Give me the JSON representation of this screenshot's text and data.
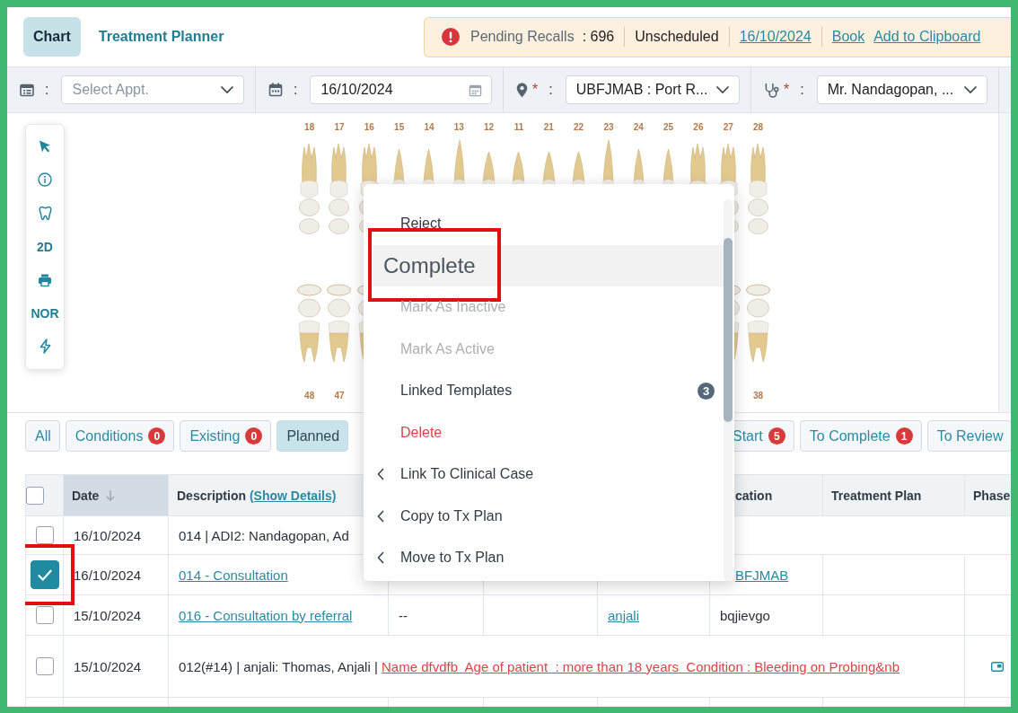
{
  "tabs": [
    {
      "label": "Chart",
      "selected": true
    },
    {
      "label": "Treatment Planner",
      "selected": false
    }
  ],
  "recall_banner": {
    "label": "Pending Recalls",
    "count": ": 696",
    "status": "Unscheduled",
    "date": "16/10/2024",
    "actions": [
      "Book",
      "Add to Clipboard"
    ]
  },
  "filters": [
    {
      "kind": "appointment",
      "separator": ":",
      "placeholder": "Select Appt."
    },
    {
      "kind": "date",
      "separator": ":",
      "value": "16/10/2024"
    },
    {
      "kind": "location",
      "required_mark": "*",
      "separator": ":",
      "value": "UBFJMAB : Port R..."
    },
    {
      "kind": "provider",
      "required_mark": "*",
      "separator": ":",
      "value": "Mr. Nandagopan, ..."
    }
  ],
  "chart_toolbar": [
    {
      "kind": "pointer"
    },
    {
      "kind": "info"
    },
    {
      "kind": "tooth"
    },
    {
      "kind": "text",
      "label": "2D"
    },
    {
      "kind": "print"
    },
    {
      "kind": "text",
      "label": "NOR"
    },
    {
      "kind": "bolt"
    }
  ],
  "tooth_chart": {
    "upper_numbers": [
      "18",
      "17",
      "16",
      "15",
      "14",
      "13",
      "12",
      "11",
      "21",
      "22",
      "23",
      "24",
      "25",
      "26",
      "27",
      "28"
    ],
    "lower_numbers": [
      "48",
      "47",
      "38"
    ]
  },
  "filter_chips": [
    {
      "label": "All",
      "selected": false
    },
    {
      "label": "Conditions",
      "count": "0",
      "selected": false
    },
    {
      "label": "Existing",
      "count": "0",
      "selected": false
    },
    {
      "label": "Planned",
      "selected": true
    },
    {
      "label": "Start",
      "count": "5",
      "selected": false
    },
    {
      "label": "To Complete",
      "count": "1",
      "selected": false
    },
    {
      "label": "To Review",
      "selected": false
    }
  ],
  "table": {
    "all_checked": false,
    "columns": [
      {
        "label": "Date",
        "sorted": true
      },
      {
        "label": "Description",
        "link": "(Show Details)",
        "sorted": false
      },
      {
        "label": "cation",
        "sorted": false
      },
      {
        "label": "Treatment Plan",
        "sorted": false
      },
      {
        "label": "Phase",
        "sorted": false
      }
    ],
    "rows": [
      {
        "kind": "summary",
        "checked": false,
        "highlighted": false,
        "date": "16/10/2024",
        "description": [
          {
            "kind": "plain",
            "text": "014 | ADI2: Nandagopan, Ad"
          }
        ]
      },
      {
        "kind": "detail",
        "checked": true,
        "highlighted": true,
        "date": "16/10/2024",
        "description": [
          {
            "kind": "link",
            "text": "014 - Consultation"
          }
        ],
        "location": {
          "kind": "link",
          "text": "BFJMAB"
        }
      },
      {
        "kind": "detail",
        "checked": false,
        "highlighted": false,
        "date": "15/10/2024",
        "description": [
          {
            "kind": "link",
            "text": "016 - Consultation by referral"
          }
        ],
        "column_4": {
          "kind": "plain",
          "text": "--"
        },
        "column_6": {
          "kind": "link",
          "text": "anjali"
        },
        "location": {
          "kind": "plain",
          "text": "bqjievgo"
        }
      },
      {
        "kind": "note",
        "checked": false,
        "highlighted": false,
        "date": "15/10/2024",
        "description": [
          {
            "kind": "plain",
            "text": "012(#14) | anjali: Thomas, Anjali | "
          },
          {
            "kind": "alert-link",
            "text": "Name dfvdfb  Age of patient  : more than 18 years  Condition : Bleeding on Probing&nb"
          }
        ]
      }
    ]
  },
  "context_menu": {
    "items": [
      {
        "label": "Reject",
        "kind": "normal",
        "hovered": false,
        "highlighted": false
      },
      {
        "label": "Complete",
        "kind": "normal",
        "hovered": true,
        "highlighted": true
      },
      {
        "label": "Mark As Inactive",
        "kind": "disabled",
        "hovered": false,
        "highlighted": false
      },
      {
        "label": "Mark As Active",
        "kind": "disabled",
        "hovered": false,
        "highlighted": false
      },
      {
        "label": "Linked Templates",
        "kind": "normal",
        "count": "3",
        "hovered": false,
        "highlighted": false
      },
      {
        "label": "Delete",
        "kind": "danger",
        "hovered": false,
        "highlighted": false
      },
      {
        "label": "Link To Clinical Case",
        "kind": "submenu",
        "hovered": false,
        "highlighted": false
      },
      {
        "label": "Copy to Tx Plan",
        "kind": "submenu",
        "hovered": false,
        "highlighted": false
      },
      {
        "label": "Move to Tx Plan",
        "kind": "submenu",
        "hovered": false,
        "highlighted": false
      }
    ]
  }
}
